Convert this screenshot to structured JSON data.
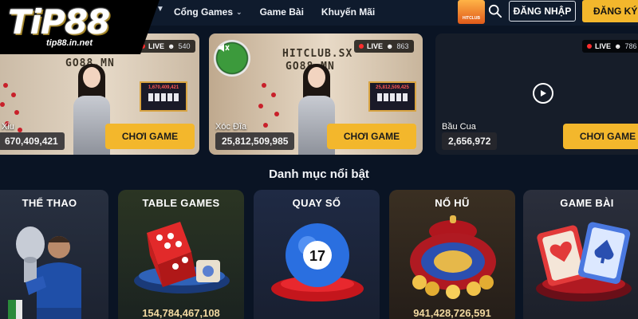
{
  "brand": {
    "logo_text": "TiP88",
    "domain": "tip88.in.net"
  },
  "nav": {
    "items": [
      {
        "label": "Cổng Games",
        "has_dropdown": true
      },
      {
        "label": "Game Bài"
      },
      {
        "label": "Khuyến Mãi"
      }
    ]
  },
  "header": {
    "promo_thumb_label": "HITCLUB",
    "login_label": "ĐĂNG NHẬP",
    "register_label": "ĐĂNG KÝ"
  },
  "live_games": [
    {
      "room_sign": "GO88.MN",
      "live_label": "LIVE",
      "viewers": "540",
      "name": "Xỉu",
      "jackpot": "670,409,421",
      "cta": "CHƠI GAME",
      "board_value": "1,670,409,421"
    },
    {
      "room_sign_top": "HITCLUB.SX",
      "room_sign": "GO88.MN",
      "live_label": "LIVE",
      "viewers": "863",
      "name": "Xóc Đĩa",
      "jackpot": "25,812,509,985",
      "cta": "CHƠI GAME",
      "board_value": "25,812,509,425"
    },
    {
      "live_label": "LIVE",
      "viewers": "786",
      "name": "Bầu Cua",
      "jackpot": "2,656,972",
      "cta": "CHƠI GAME"
    }
  ],
  "section": {
    "title": "Danh mục nổi bật"
  },
  "categories": [
    {
      "title": "THỂ THAO",
      "value": ""
    },
    {
      "title": "TABLE GAMES",
      "value": "154,784,467,108"
    },
    {
      "title": "QUAY SỐ",
      "value": ""
    },
    {
      "title": "NỔ HŨ",
      "value": "941,428,726,591"
    },
    {
      "title": "GAME BÀI",
      "value": ""
    }
  ],
  "lottery_ball_number": "17",
  "colors": {
    "accent": "#f3b72c",
    "background": "#0a1424",
    "live_dot": "#ff2d2d"
  },
  "icons": [
    "search-icon",
    "chevron-down-icon",
    "play-icon",
    "mute-icon",
    "viewers-icon"
  ]
}
